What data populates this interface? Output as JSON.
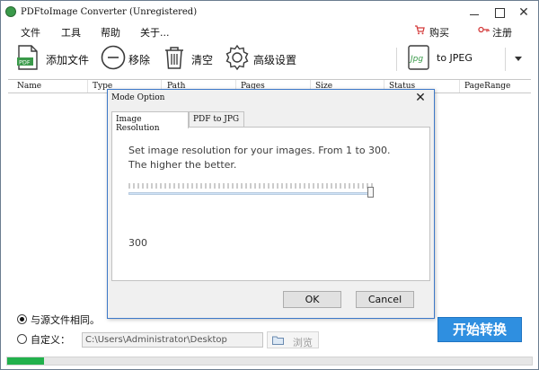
{
  "window": {
    "title": "PDFtoImage Converter (Unregistered)",
    "controls": [
      "minimize",
      "maximize",
      "close"
    ]
  },
  "menu": {
    "items": [
      "文件",
      "工具",
      "帮助",
      "关于..."
    ],
    "buy_label": "购买",
    "register_label": "注册"
  },
  "toolbar": {
    "add_file": "添加文件",
    "remove": "移除",
    "clear": "清空",
    "advanced": "高级设置",
    "format": "to JPEG",
    "format_icon_text": "Jpg"
  },
  "table": {
    "columns": [
      "Name",
      "Type",
      "Path",
      "Pages",
      "Size",
      "Status",
      "PageRange"
    ]
  },
  "output": {
    "same_as_source": "与源文件相同。",
    "custom": "自定义：",
    "path": "C:\\Users\\Administrator\\Desktop",
    "browse": "浏览",
    "selected": "same_as_source",
    "start": "开始转换",
    "progress": 0.07
  },
  "dialog": {
    "title": "Mode Option",
    "tabs": [
      "Image Resolution",
      "PDF to JPG"
    ],
    "active_tab": 0,
    "description": "Set image resolution for your images. From 1 to 300.  The higher the better.",
    "slider": {
      "min": 1,
      "max": 300,
      "value": 300
    },
    "value_label": "300",
    "ok": "OK",
    "cancel": "Cancel"
  },
  "colors": {
    "accent": "#2f8fe0",
    "progress": "#22b14c",
    "dialog_border": "#3c78c8",
    "buy_icon": "#d43c3c"
  }
}
